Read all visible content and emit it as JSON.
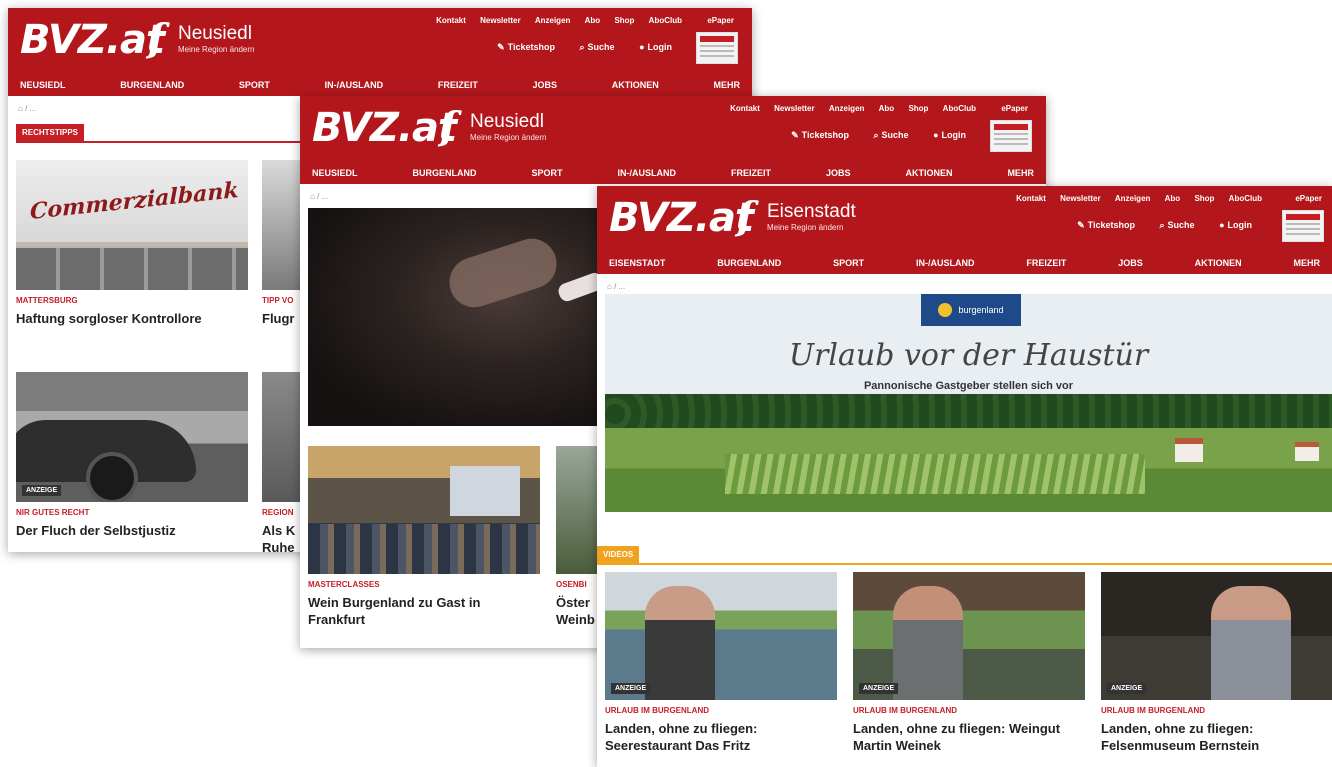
{
  "w1": {
    "logo": "BVZ.at",
    "region": "Neusiedl",
    "region_sub": "Meine Region ändern",
    "toplinks": [
      "Kontakt",
      "Newsletter",
      "Anzeigen",
      "Abo",
      "Shop",
      "AboClub",
      "ePaper"
    ],
    "actions": [
      "Ticketshop",
      "Suche",
      "Login"
    ],
    "nav": [
      "NEUSIEDL",
      "BURGENLAND",
      "SPORT",
      "IN-/AUSLAND",
      "FREIZEIT",
      "JOBS",
      "AKTIONEN",
      "MEHR"
    ],
    "section": "RECHTSTIPPS",
    "cards": [
      {
        "kicker": "MATTERSBURG",
        "title": "Haftung sorgloser Kontrollore",
        "badge": ""
      },
      {
        "kicker": "TIPP VO",
        "title": "Flugr",
        "badge": ""
      },
      {
        "kicker": "NIR GUTES RECHT",
        "title": "Der Fluch der Selbstjustiz",
        "badge": "ANZEIGE"
      },
      {
        "kicker": "REGION",
        "title": "Als K\nRuhe",
        "badge": ""
      }
    ],
    "bank_sign": "Commerzialbank"
  },
  "w2": {
    "logo": "BVZ.at",
    "region": "Neusiedl",
    "region_sub": "Meine Region ändern",
    "toplinks": [
      "Kontakt",
      "Newsletter",
      "Anzeigen",
      "Abo",
      "Shop",
      "AboClub",
      "ePaper"
    ],
    "actions": [
      "Ticketshop",
      "Suche",
      "Login"
    ],
    "nav": [
      "NEUSIEDL",
      "BURGENLAND",
      "SPORT",
      "IN-/AUSLAND",
      "FREIZEIT",
      "JOBS",
      "AKTIONEN",
      "MEHR"
    ],
    "cards": [
      {
        "kicker": "MASTERCLASSES",
        "title": "Wein Burgenland zu Gast in Frankfurt"
      },
      {
        "kicker": "OSENBI",
        "title": "Öster\nWeinb"
      }
    ]
  },
  "w3": {
    "logo": "BVZ.at",
    "region": "Eisenstadt",
    "region_sub": "Meine Region ändern",
    "toplinks": [
      "Kontakt",
      "Newsletter",
      "Anzeigen",
      "Abo",
      "Shop",
      "AboClub",
      "ePaper"
    ],
    "actions": [
      "Ticketshop",
      "Suche",
      "Login"
    ],
    "nav": [
      "EISENSTADT",
      "BURGENLAND",
      "SPORT",
      "IN-/AUSLAND",
      "FREIZEIT",
      "JOBS",
      "AKTIONEN",
      "MEHR"
    ],
    "hero": {
      "badge": "burgenland",
      "script": "Urlaub vor der Haustür",
      "sub": "Pannonische Gastgeber stellen sich vor"
    },
    "section": "VIDEOS",
    "cards": [
      {
        "kicker": "URLAUB IM BURGENLAND",
        "title": "Landen, ohne zu fliegen: Seerestaurant Das Fritz",
        "badge": "ANZEIGE"
      },
      {
        "kicker": "URLAUB IM BURGENLAND",
        "title": "Landen, ohne zu fliegen: Weingut Martin Weinek",
        "badge": "ANZEIGE"
      },
      {
        "kicker": "URLAUB IM BURGENLAND",
        "title": "Landen, ohne zu fliegen: Felsenmuseum Bernstein",
        "badge": "ANZEIGE"
      }
    ]
  }
}
